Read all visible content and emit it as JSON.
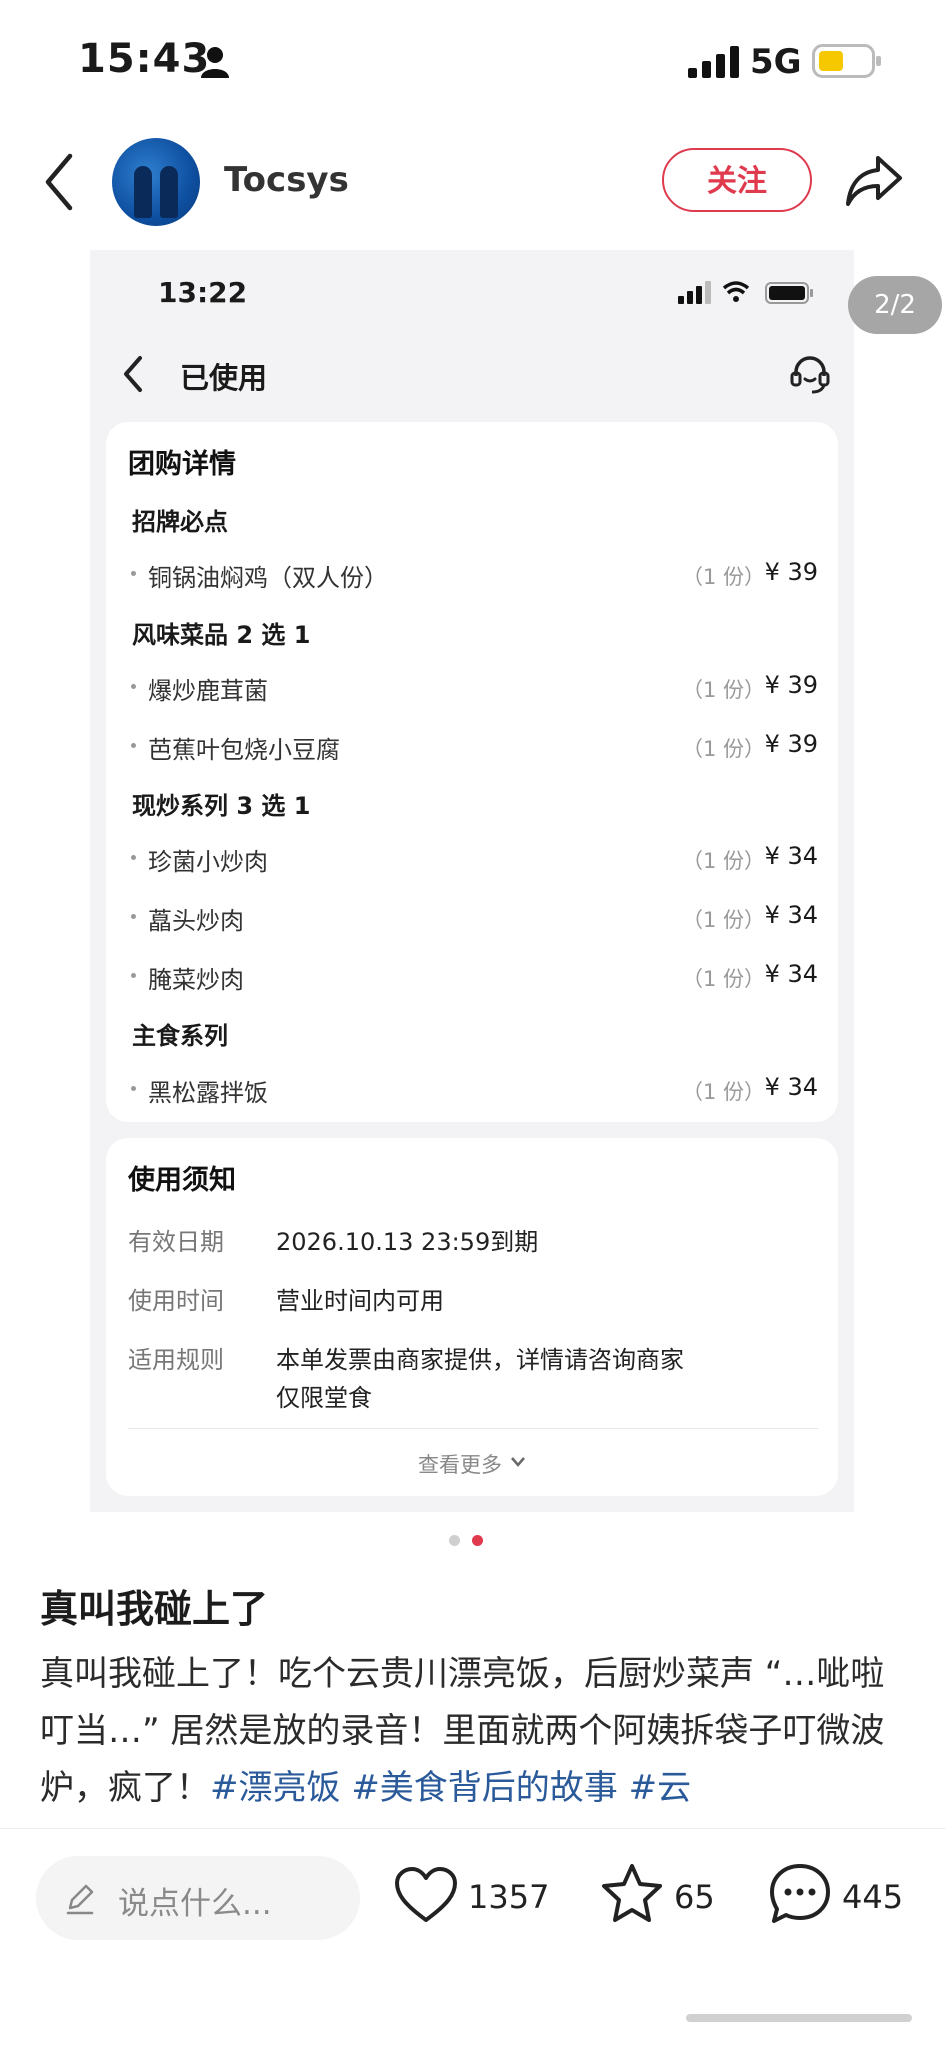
{
  "status_bar": {
    "time": "15:43",
    "network": "5G",
    "battery_color": "#f5c800"
  },
  "header": {
    "username": "Tocsys",
    "follow_label": "关注",
    "accent_color": "#e03a4f"
  },
  "image_pager": {
    "label": "2/2",
    "current": 2,
    "total": 2
  },
  "inner_screen": {
    "status_time": "13:22",
    "nav_title": "已使用",
    "group_card": {
      "title": "团购详情",
      "sections": [
        {
          "name": "招牌必点",
          "items": [
            {
              "name": "铜锅油焖鸡（双人份）",
              "qty": "（1 份）",
              "price": "¥ 39"
            }
          ]
        },
        {
          "name": "风味菜品 2 选 1",
          "items": [
            {
              "name": "爆炒鹿茸菌",
              "qty": "（1 份）",
              "price": "¥ 39"
            },
            {
              "name": "芭蕉叶包烧小豆腐",
              "qty": "（1 份）",
              "price": "¥ 39"
            }
          ]
        },
        {
          "name": "现炒系列 3 选 1",
          "items": [
            {
              "name": "珍菌小炒肉",
              "qty": "（1 份）",
              "price": "¥ 34"
            },
            {
              "name": "藠头炒肉",
              "qty": "（1 份）",
              "price": "¥ 34"
            },
            {
              "name": "腌菜炒肉",
              "qty": "（1 份）",
              "price": "¥ 34"
            }
          ]
        },
        {
          "name": "主食系列",
          "items": [
            {
              "name": "黑松露拌饭",
              "qty": "（1 份）",
              "price": "¥ 34"
            }
          ]
        }
      ]
    },
    "usage_card": {
      "title": "使用须知",
      "rows": [
        {
          "label": "有效日期",
          "value": "2026.10.13 23:59到期"
        },
        {
          "label": "使用时间",
          "value": "营业时间内可用"
        },
        {
          "label": "适用规则",
          "value": "本单发票由商家提供，详情请咨询商家",
          "value2": "仅限堂食"
        }
      ],
      "more_label": "查看更多"
    }
  },
  "post": {
    "title": "真叫我碰上了",
    "body": "真叫我碰上了！吃个云贵川漂亮饭，后厨炒菜声 “…呲啦叮当…” 居然是放的录音！里面就两个阿姨拆袋子叮微波炉，疯了！",
    "tags": [
      "#漂亮饭",
      "#美食背后的故事",
      "#云"
    ]
  },
  "bottom_bar": {
    "comment_placeholder": "说点什么...",
    "likes": "1357",
    "favorites": "65",
    "comments": "445"
  }
}
